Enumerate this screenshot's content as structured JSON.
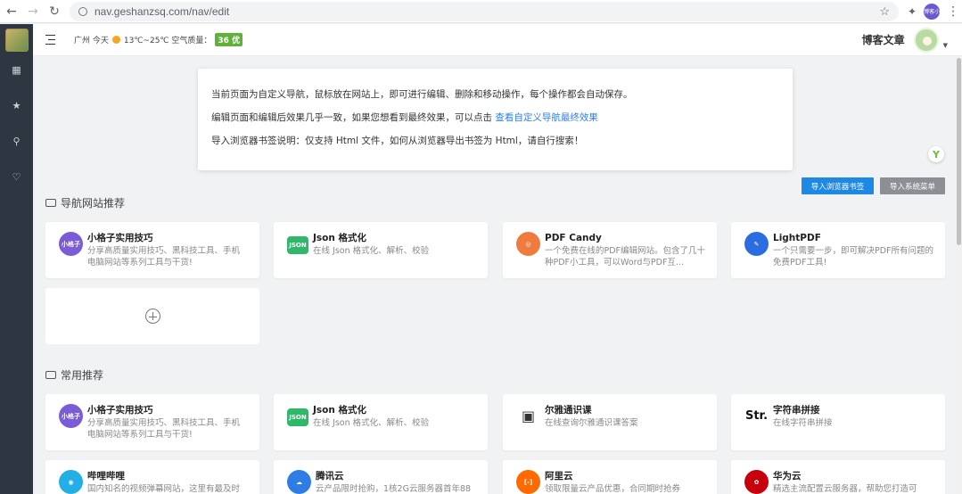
{
  "browser": {
    "url": "nav.geshanzsq.com/nav/edit",
    "profile_text": "博客小"
  },
  "topbar": {
    "weather_city": "广州 今天",
    "weather_temp": "13℃~25℃ 空气质量：",
    "aqi_value": "36 优",
    "aqi_color": "#5fb139",
    "blog_link": "博客文章"
  },
  "notice": {
    "line1": "当前页面为自定义导航，鼠标放在网站上，即可进行编辑、删除和移动操作，每个操作都会自动保存。",
    "line2_prefix": "编辑页面和编辑后效果几乎一致，如果您想看到最终效果，可以点击",
    "line2_link": "查看自定义导航最终效果",
    "line3": "导入浏览器书签说明：仅支持 Html 文件，如何从浏览器导出书签为 Html，请自行搜索！"
  },
  "buttons": {
    "import_bookmarks": "导入浏览器书签",
    "import_system_menu": "导入系统菜单"
  },
  "sections": [
    {
      "title": "导航网站推荐",
      "cards": [
        {
          "title": "小格子实用技巧",
          "desc": "分享高质量实用技巧、黑科技工具、手机电脑网站等系列工具与干货!",
          "icon": "xiaogezi-icon",
          "icon_text": "小格子",
          "color": "#7b5cd6"
        },
        {
          "title": "Json 格式化",
          "desc": "在线 Json 格式化、解析、校验",
          "icon": "json-icon",
          "icon_text": "JSON",
          "color": "#2fb86a"
        },
        {
          "title": "PDF Candy",
          "desc": "一个免费在线的PDF编辑网站。包含了几十种PDF小工具，可以Word与PDF互…",
          "icon": "pdf-candy-icon",
          "icon_text": "◎",
          "color": "#f07b3f"
        },
        {
          "title": "LightPDF",
          "desc": "一个只需要一步，即可解决PDF所有问题的免费PDF工具!",
          "icon": "lightpdf-icon",
          "icon_text": "✎",
          "color": "#2b6de0"
        }
      ]
    },
    {
      "title": "常用推荐",
      "cards": [
        {
          "title": "小格子实用技巧",
          "desc": "分享高质量实用技巧、黑科技工具、手机电脑网站等系列工具与干货!",
          "icon": "xiaogezi-icon",
          "icon_text": "小格子",
          "color": "#7b5cd6"
        },
        {
          "title": "Json 格式化",
          "desc": "在线 Json 格式化、解析、校验",
          "icon": "json-icon",
          "icon_text": "JSON",
          "color": "#2fb86a"
        },
        {
          "title": "尔雅通识课",
          "desc": "在线查询尔雅通识课答案",
          "icon": "erya-icon",
          "icon_text": "▣",
          "color": "#333333"
        },
        {
          "title": "字符串拼接",
          "desc": "在线字符串拼接",
          "icon": "str-icon",
          "icon_text": "Str.",
          "color": "#111111"
        },
        {
          "title": "哔哩哔哩",
          "desc": "国内知名的视频弹幕网站，这里有最及时",
          "icon": "bilibili-icon",
          "icon_text": "◉",
          "color": "#23aee5"
        },
        {
          "title": "腾讯云",
          "desc": "云产品限时抢购，1核2G云服务器首年88",
          "icon": "tencent-cloud-icon",
          "icon_text": "☁",
          "color": "#2e7ce6"
        },
        {
          "title": "阿里云",
          "desc": "领取限量云产品优惠，合同期时抢券",
          "icon": "aliyun-icon",
          "icon_text": "[-]",
          "color": "#ff6a00"
        },
        {
          "title": "华为云",
          "desc": "精选主流配置云服务器，帮助您打造可",
          "icon": "huawei-cloud-icon",
          "icon_text": "✿",
          "color": "#c7000b"
        }
      ]
    }
  ]
}
